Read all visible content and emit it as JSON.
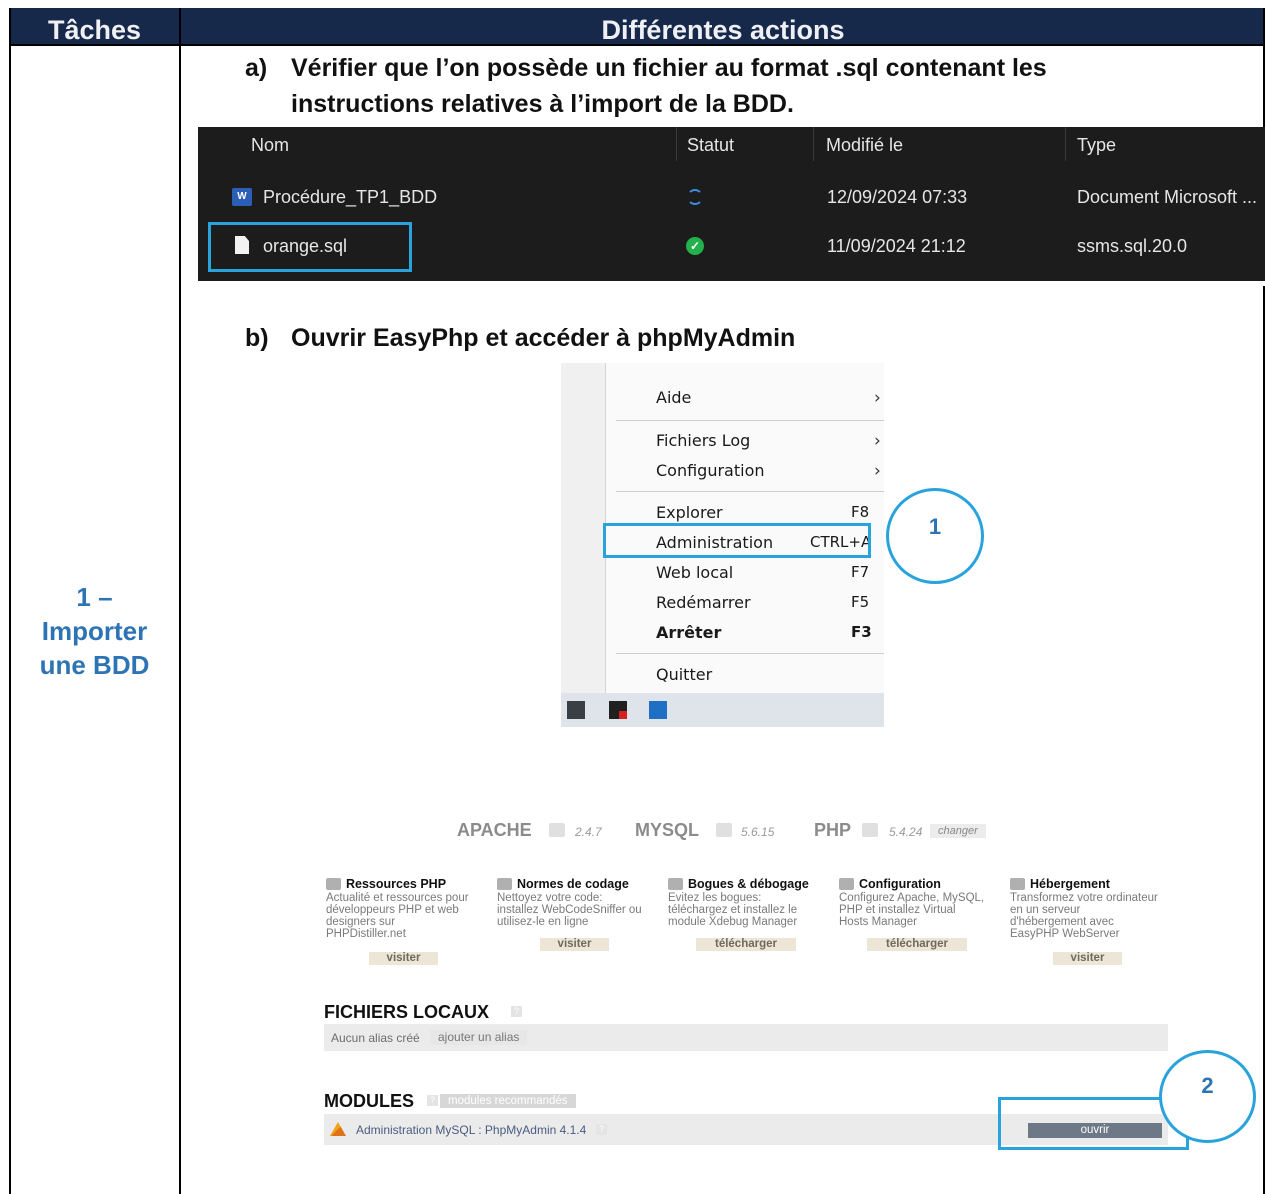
{
  "table": {
    "header_left": "Tâches",
    "header_right": "Différentes actions",
    "task_label_lines": [
      "1 –",
      "Importer",
      "une BDD"
    ]
  },
  "steps": {
    "a_letter": "a)",
    "a_line1": "Vérifier que l’on possède un fichier au format .sql contenant les",
    "a_line2": "instructions relatives à l’import de la BDD.",
    "b_letter": "b)",
    "b_text": "Ouvrir EasyPhp et accéder à phpMyAdmin"
  },
  "explorer": {
    "columns": [
      "Nom",
      "Statut",
      "Modifié le",
      "Type"
    ],
    "rows": [
      {
        "name": "Procédure_TP1_BDD",
        "status_icon": "sync-icon",
        "modified": "12/09/2024 07:33",
        "type": "Document Microsoft ..."
      },
      {
        "name": "orange.sql",
        "status_icon": "check-icon",
        "modified": "11/09/2024 21:12",
        "type": "ssms.sql.20.0"
      }
    ],
    "highlight_color": "#29a3dc"
  },
  "context_menu": {
    "items": [
      {
        "label": "Aide",
        "shortcut": "",
        "submenu": true
      },
      {
        "label": "Fichiers Log",
        "shortcut": "",
        "submenu": true
      },
      {
        "label": "Configuration",
        "shortcut": "",
        "submenu": true
      },
      {
        "label": "Explorer",
        "shortcut": "F8"
      },
      {
        "label": "Administration",
        "shortcut": "CTRL+A"
      },
      {
        "label": "Web local",
        "shortcut": "F7"
      },
      {
        "label": "Redémarrer",
        "shortcut": "F5"
      },
      {
        "label": "Arrêter",
        "shortcut": "F3"
      },
      {
        "label": "Quitter",
        "shortcut": ""
      }
    ],
    "callout": "1"
  },
  "easyphp": {
    "apache_label": "APACHE",
    "apache_version": "2.4.7",
    "mysql_label": "MYSQL",
    "mysql_version": "5.6.15",
    "php_label": "PHP",
    "php_version": "5.4.24",
    "changer": "changer",
    "cards": [
      {
        "title": "Ressources PHP",
        "desc": [
          "Actualité et ressources pour",
          "développeurs PHP et web",
          "designers sur",
          "PHPDistiller.net"
        ],
        "button": "visiter"
      },
      {
        "title": "Normes de codage",
        "desc": [
          "Nettoyez votre code:",
          "installez WebCodeSniffer ou",
          "utilisez-le en ligne"
        ],
        "button": "visiter"
      },
      {
        "title": "Bogues & débogage",
        "desc": [
          "Evitez les bogues:",
          "téléchargez et installez le",
          "module Xdebug Manager"
        ],
        "button": "télécharger"
      },
      {
        "title": "Configuration",
        "desc": [
          "Configurez Apache, MySQL,",
          "PHP et installez Virtual",
          "Hosts Manager"
        ],
        "button": "télécharger"
      },
      {
        "title": "Hébergement",
        "desc": [
          "Transformez votre ordinateur",
          "en un serveur",
          "d'hébergement avec",
          "EasyPHP WebServer"
        ],
        "button": "visiter"
      }
    ],
    "local_files_title": "FICHIERS LOCAUX",
    "no_alias": "Aucun alias créé",
    "add_alias": "ajouter un alias",
    "modules_title": "MODULES",
    "recommended": "modules recommandés",
    "module_name": "Administration MySQL : PhpMyAdmin 4.1.4",
    "open": "ouvrir",
    "callout": "2"
  }
}
